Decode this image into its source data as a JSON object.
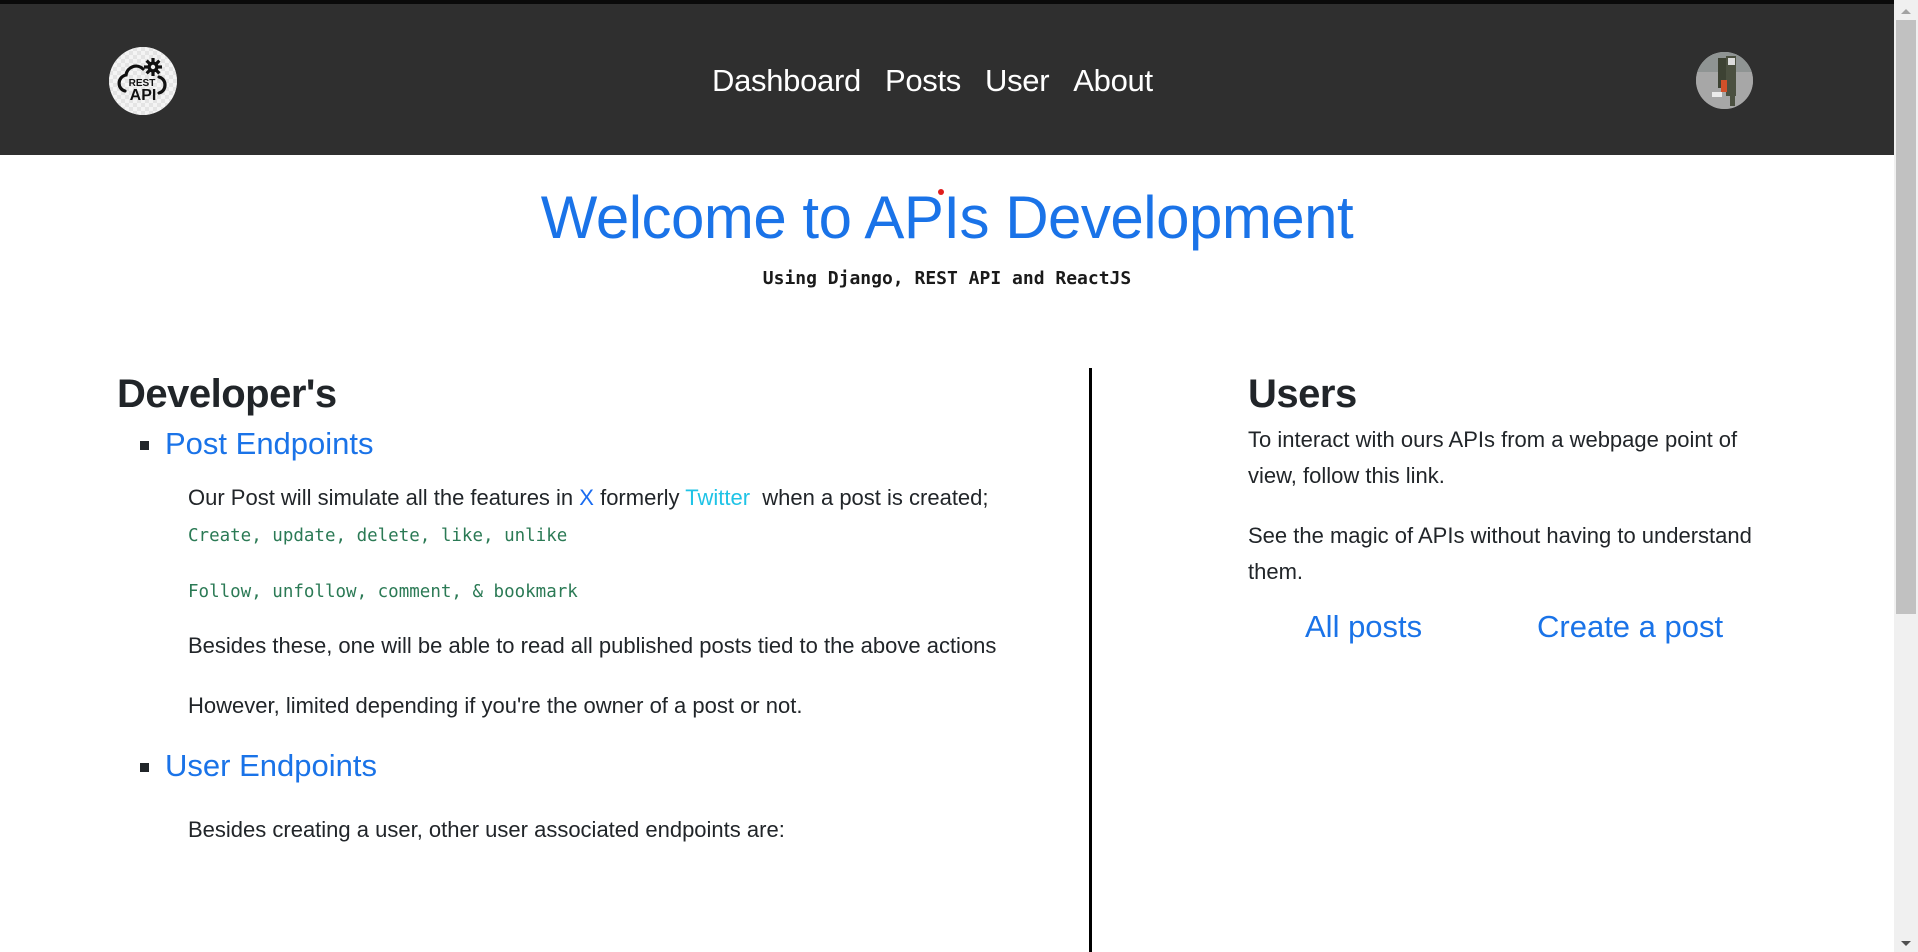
{
  "header": {
    "logo": {
      "icon": "rest-api-cloud-gear-logo",
      "text_top": "REST",
      "text_bottom": "API"
    },
    "nav": [
      {
        "label": "Dashboard"
      },
      {
        "label": "Posts"
      },
      {
        "label": "User"
      },
      {
        "label": "About"
      }
    ],
    "avatar": {
      "icon": "user-avatar-photo"
    }
  },
  "hero": {
    "title": "Welcome to APIs Development",
    "subtitle": "Using Django, REST API and ReactJS"
  },
  "developers": {
    "title": "Developer's",
    "endpoints": [
      {
        "label": "Post Endpoints",
        "intro_prefix": "Our Post will simulate all the features in ",
        "intro_link_x": "X",
        "intro_middle": " formerly ",
        "intro_link_twitter": "Twitter",
        "intro_suffix": "  when a post is created;",
        "code_lines": [
          "Create, update, delete, like, unlike",
          "Follow, unfollow, comment, & bookmark"
        ],
        "paragraphs": [
          "Besides these, one will be able to read all published posts tied to the above actions",
          "However, limited depending if you're the owner of a post or not."
        ]
      },
      {
        "label": "User Endpoints",
        "paragraphs": [
          "Besides creating a user, other user associated endpoints are:"
        ]
      }
    ]
  },
  "users": {
    "title": "Users",
    "paragraphs": [
      "To interact with ours APIs from a webpage point of view, follow this link.",
      "See the magic of APIs without having to understand them."
    ],
    "links": [
      {
        "label": "All posts"
      },
      {
        "label": "Create a post"
      }
    ]
  },
  "colors": {
    "header_bg": "#2f2f2f",
    "accent_blue": "#1a73e8",
    "twitter_cyan": "#1fc3e6",
    "code_green": "#2b7a55"
  }
}
